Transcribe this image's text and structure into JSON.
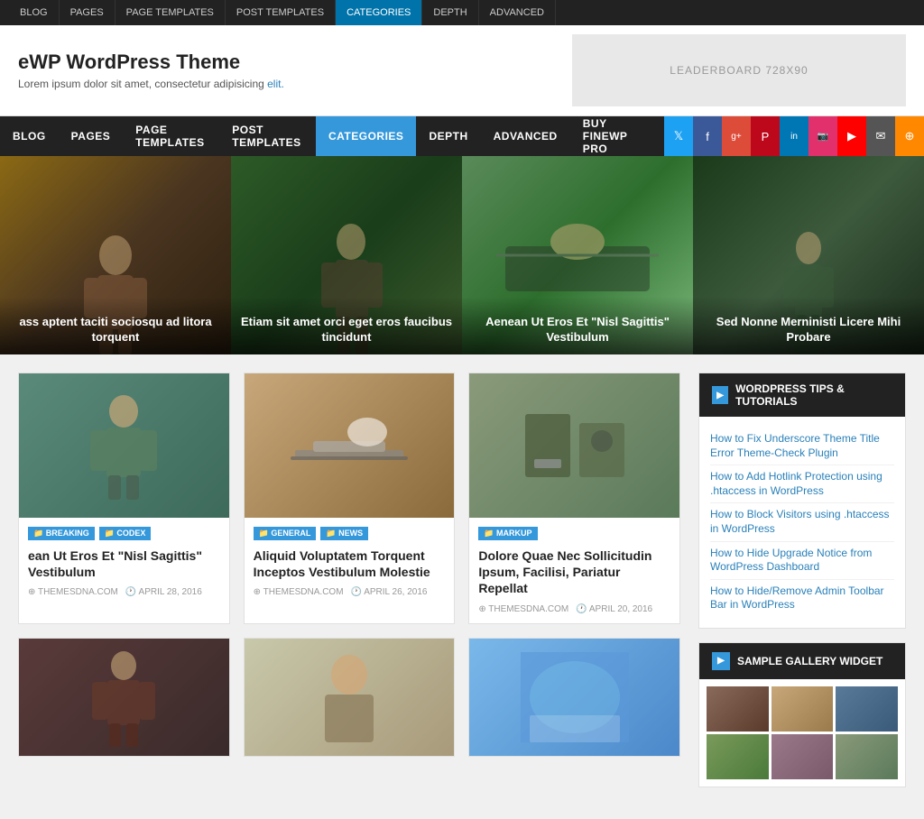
{
  "admin_bar": {
    "tabs": [
      "BLOG",
      "PAGES",
      "PAGE TEMPLATES",
      "POST TEMPLATES",
      "CATEGORIES",
      "DEPTH",
      "ADVANCED"
    ],
    "active_tab": "CATEGORIES"
  },
  "header": {
    "title": "eWP WordPress Theme",
    "tagline": "Lorem ipsum dolor sit amet, consectetur adipisicing elit.",
    "ad_label": "LEADERBOARD 728X90"
  },
  "nav": {
    "items": [
      "BLOG",
      "PAGES",
      "PAGE TEMPLATES",
      "POST TEMPLATES",
      "CATEGORIES",
      "DEPTH",
      "ADVANCED",
      "BUY FINEWP PRO"
    ],
    "active": "CATEGORIES",
    "social": [
      "twitter",
      "facebook",
      "gplus",
      "pinterest",
      "linkedin",
      "instagram",
      "youtube",
      "mail",
      "rss"
    ]
  },
  "hero": {
    "slides": [
      {
        "text": "ass aptent taciti sociosqu ad litora torquent",
        "bg": "hero-bg-1"
      },
      {
        "text": "Etiam sit amet orci eget eros faucibus tincidunt",
        "bg": "hero-bg-2"
      },
      {
        "text": "Aenean Ut Eros Et \"Nisl Sagittis\" Vestibulum",
        "bg": "hero-bg-3"
      },
      {
        "text": "Sed Nonne Merninisti Licere Mihi Probare",
        "bg": "hero-bg-4"
      }
    ]
  },
  "posts": [
    {
      "tags": [
        {
          "label": "BREAKING",
          "color": "blue"
        },
        {
          "label": "CODEX",
          "color": "blue"
        }
      ],
      "title": "ean Ut Eros Et \"Nisl Sagittis\" Vestibulum",
      "author": "THEMESDNA.COM",
      "date": "APRIL 28, 2016",
      "thumb": "thumb-bg-1"
    },
    {
      "tags": [
        {
          "label": "GENERAL",
          "color": "blue"
        },
        {
          "label": "NEWS",
          "color": "blue"
        }
      ],
      "title": "Aliquid Voluptatem Torquent Inceptos Vestibulum Molestie",
      "author": "THEMESDNA.COM",
      "date": "APRIL 26, 2016",
      "thumb": "thumb-bg-2"
    },
    {
      "tags": [
        {
          "label": "MARKUP",
          "color": "blue"
        }
      ],
      "title": "Dolore Quae Nec Sollicitudin Ipsum, Facilisi, Pariatur Repellat",
      "author": "THEMESDNA.COM",
      "date": "APRIL 20, 2016",
      "thumb": "thumb-bg-3"
    }
  ],
  "posts_bottom": [
    {
      "thumb": "thumb-bot-1"
    },
    {
      "thumb": "thumb-bot-2"
    },
    {
      "thumb": "thumb-bot-3"
    }
  ],
  "sidebar": {
    "widgets": [
      {
        "title": "WORDPRESS TIPS & TUTORIALS",
        "links": [
          "How to Fix Underscore Theme Title Error Theme-Check Plugin",
          "How to Add Hotlink Protection using .htaccess in WordPress",
          "How to Block Visitors using .htaccess in WordPress",
          "How to Hide Upgrade Notice from WordPress Dashboard",
          "How to Hide/Remove Admin Toolbar Bar in WordPress"
        ]
      },
      {
        "title": "SAMPLE GALLERY WIDGET",
        "links": []
      }
    ]
  },
  "social_icons": {
    "twitter": "𝕋",
    "facebook": "f",
    "gplus": "g+",
    "pinterest": "P",
    "linkedin": "in",
    "instagram": "📷",
    "youtube": "▶",
    "mail": "✉",
    "rss": "⊕"
  },
  "tag_icon": "📁"
}
